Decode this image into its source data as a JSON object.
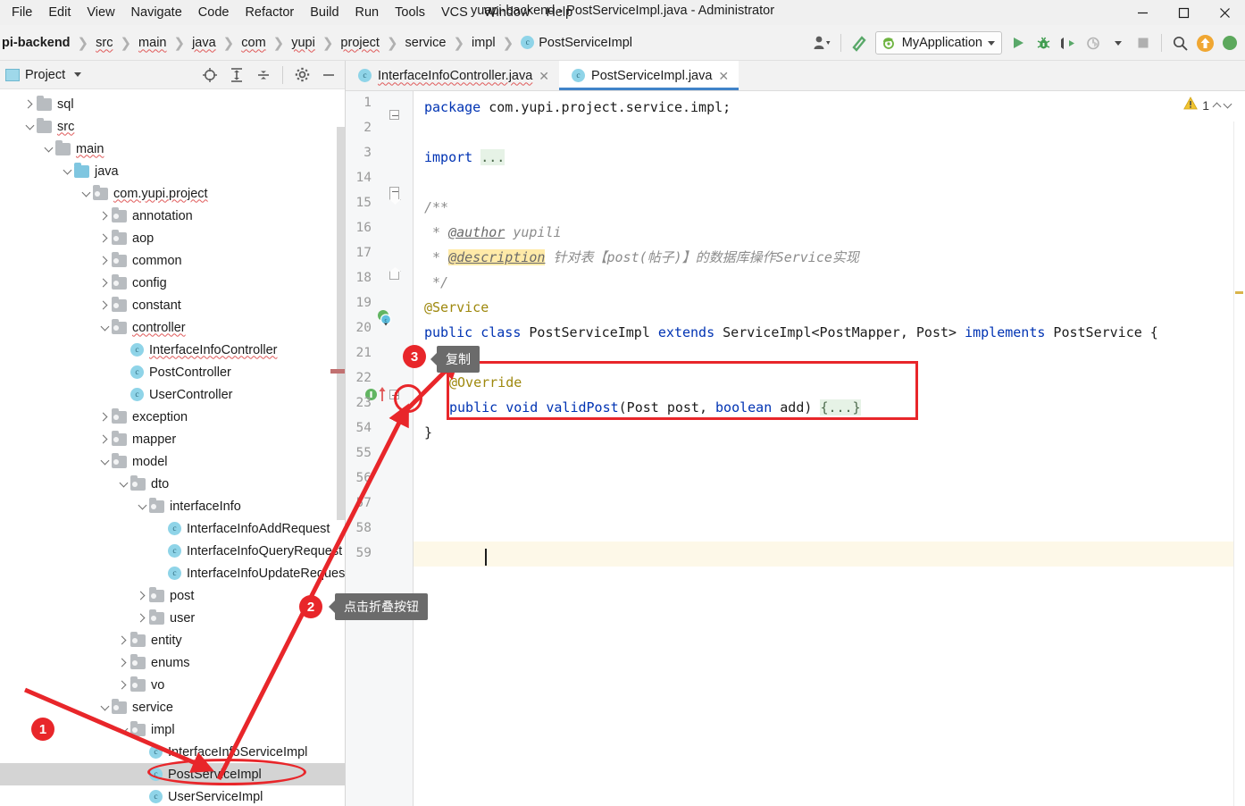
{
  "window": {
    "title": "yuapi-backend - PostServiceImpl.java - Administrator",
    "minimize": "–",
    "maximize": "□",
    "close": "✕"
  },
  "menubar": {
    "items": [
      {
        "label": "File"
      },
      {
        "label": "Edit"
      },
      {
        "label": "View"
      },
      {
        "label": "Navigate"
      },
      {
        "label": "Code"
      },
      {
        "label": "Refactor"
      },
      {
        "label": "Build"
      },
      {
        "label": "Run"
      },
      {
        "label": "Tools"
      },
      {
        "label": "VCS"
      },
      {
        "label": "Window"
      },
      {
        "label": "Help"
      }
    ]
  },
  "breadcrumb": {
    "separator": "❯",
    "items": [
      {
        "label": "pi-backend",
        "bold": true,
        "squiggle": false
      },
      {
        "label": "src",
        "bold": false,
        "squiggle": true
      },
      {
        "label": "main",
        "bold": false,
        "squiggle": true
      },
      {
        "label": "java",
        "bold": false,
        "squiggle": true
      },
      {
        "label": "com",
        "bold": false,
        "squiggle": true
      },
      {
        "label": "yupi",
        "bold": false,
        "squiggle": true
      },
      {
        "label": "project",
        "bold": false,
        "squiggle": true
      },
      {
        "label": "service",
        "bold": false,
        "squiggle": false
      },
      {
        "label": "impl",
        "bold": false,
        "squiggle": false
      }
    ],
    "current_class": "PostServiceImpl",
    "class_icon_letter": "c"
  },
  "toolbar": {
    "profile_icon": "user-profile-icon",
    "build_icon": "build-hammer-icon",
    "run_config": "MyApplication",
    "run_icon": "run-icon",
    "debug_icon": "debug-icon",
    "coverage_icon": "run-with-coverage-icon",
    "profiler_icon": "profiler-icon",
    "stop_icon": "stop-icon",
    "search_icon": "search-everywhere-icon",
    "update_icon": "update-project-icon"
  },
  "project_panel": {
    "title": "Project",
    "header_icons": [
      {
        "name": "locate-icon"
      },
      {
        "name": "expand-all-icon"
      },
      {
        "name": "collapse-all-icon"
      },
      {
        "name": "settings-gear-icon"
      },
      {
        "name": "hide-panel-icon"
      }
    ],
    "tree": [
      {
        "label": "sql",
        "indent": 1,
        "type": "folder",
        "state": "collapsed",
        "squiggle": false,
        "selected": false
      },
      {
        "label": "src",
        "indent": 1,
        "type": "folder",
        "state": "expanded",
        "squiggle": true,
        "selected": false
      },
      {
        "label": "main",
        "indent": 2,
        "type": "folder",
        "state": "expanded",
        "squiggle": true,
        "selected": false
      },
      {
        "label": "java",
        "indent": 3,
        "type": "source",
        "state": "expanded",
        "squiggle": false,
        "selected": false
      },
      {
        "label": "com.yupi.project",
        "indent": 4,
        "type": "package",
        "state": "expanded",
        "squiggle": true,
        "selected": false
      },
      {
        "label": "annotation",
        "indent": 5,
        "type": "package",
        "state": "collapsed",
        "squiggle": false,
        "selected": false
      },
      {
        "label": "aop",
        "indent": 5,
        "type": "package",
        "state": "collapsed",
        "squiggle": false,
        "selected": false
      },
      {
        "label": "common",
        "indent": 5,
        "type": "package",
        "state": "collapsed",
        "squiggle": false,
        "selected": false
      },
      {
        "label": "config",
        "indent": 5,
        "type": "package",
        "state": "collapsed",
        "squiggle": false,
        "selected": false
      },
      {
        "label": "constant",
        "indent": 5,
        "type": "package",
        "state": "collapsed",
        "squiggle": false,
        "selected": false
      },
      {
        "label": "controller",
        "indent": 5,
        "type": "package",
        "state": "expanded",
        "squiggle": true,
        "selected": false
      },
      {
        "label": "InterfaceInfoController",
        "indent": 6,
        "type": "class",
        "state": "leaf",
        "squiggle": true,
        "selected": false
      },
      {
        "label": "PostController",
        "indent": 6,
        "type": "class",
        "state": "leaf",
        "squiggle": false,
        "selected": false
      },
      {
        "label": "UserController",
        "indent": 6,
        "type": "class",
        "state": "leaf",
        "squiggle": false,
        "selected": false
      },
      {
        "label": "exception",
        "indent": 5,
        "type": "package",
        "state": "collapsed",
        "squiggle": false,
        "selected": false
      },
      {
        "label": "mapper",
        "indent": 5,
        "type": "package",
        "state": "collapsed",
        "squiggle": false,
        "selected": false
      },
      {
        "label": "model",
        "indent": 5,
        "type": "package",
        "state": "expanded",
        "squiggle": false,
        "selected": false
      },
      {
        "label": "dto",
        "indent": 6,
        "type": "package",
        "state": "expanded",
        "squiggle": false,
        "selected": false
      },
      {
        "label": "interfaceInfo",
        "indent": 7,
        "type": "package",
        "state": "expanded",
        "squiggle": false,
        "selected": false
      },
      {
        "label": "InterfaceInfoAddRequest",
        "indent": 8,
        "type": "class",
        "state": "leaf",
        "squiggle": false,
        "selected": false
      },
      {
        "label": "InterfaceInfoQueryRequest",
        "indent": 8,
        "type": "class",
        "state": "leaf",
        "squiggle": false,
        "selected": false
      },
      {
        "label": "InterfaceInfoUpdateRequest",
        "indent": 8,
        "type": "class",
        "state": "leaf",
        "squiggle": false,
        "selected": false
      },
      {
        "label": "post",
        "indent": 7,
        "type": "package",
        "state": "collapsed",
        "squiggle": false,
        "selected": false
      },
      {
        "label": "user",
        "indent": 7,
        "type": "package",
        "state": "collapsed",
        "squiggle": false,
        "selected": false
      },
      {
        "label": "entity",
        "indent": 6,
        "type": "package",
        "state": "collapsed",
        "squiggle": false,
        "selected": false
      },
      {
        "label": "enums",
        "indent": 6,
        "type": "package",
        "state": "collapsed",
        "squiggle": false,
        "selected": false
      },
      {
        "label": "vo",
        "indent": 6,
        "type": "package",
        "state": "collapsed",
        "squiggle": false,
        "selected": false
      },
      {
        "label": "service",
        "indent": 5,
        "type": "package",
        "state": "expanded",
        "squiggle": false,
        "selected": false
      },
      {
        "label": "impl",
        "indent": 6,
        "type": "package",
        "state": "expanded",
        "squiggle": false,
        "selected": false
      },
      {
        "label": "InterfaceInfoServiceImpl",
        "indent": 7,
        "type": "class",
        "state": "leaf",
        "squiggle": false,
        "selected": false
      },
      {
        "label": "PostServiceImpl",
        "indent": 7,
        "type": "class",
        "state": "leaf",
        "squiggle": false,
        "selected": true
      },
      {
        "label": "UserServiceImpl",
        "indent": 7,
        "type": "class",
        "state": "leaf",
        "squiggle": false,
        "selected": false
      }
    ]
  },
  "editor": {
    "tabs": [
      {
        "label": "InterfaceInfoController.java",
        "active": false,
        "squiggle": true,
        "close": "✕",
        "icon_letter": "c"
      },
      {
        "label": "PostServiceImpl.java",
        "active": true,
        "squiggle": false,
        "close": "✕",
        "icon_letter": "c"
      }
    ],
    "line_numbers": [
      "1",
      "2",
      "3",
      "14",
      "15",
      "16",
      "17",
      "18",
      "19",
      "20",
      "21",
      "22",
      "23",
      "54",
      "55",
      "56",
      "57",
      "58",
      "59"
    ],
    "inspection": {
      "warning_icon": "warning-triangle-icon",
      "warning_count": "1",
      "prev": "chevron-up-icon",
      "next": "chevron-down-icon"
    },
    "code_lines": [
      {
        "n": "1",
        "tokens": [
          {
            "t": "package",
            "c": "kw"
          },
          {
            "t": " com.yupi.project.service.impl;",
            "c": "txt"
          }
        ]
      },
      {
        "n": "2",
        "tokens": []
      },
      {
        "n": "3",
        "tokens": [
          {
            "t": "import",
            "c": "kw"
          },
          {
            "t": " ",
            "c": "txt"
          },
          {
            "t": "...",
            "c": "fold-ph"
          }
        ]
      },
      {
        "n": "14",
        "tokens": []
      },
      {
        "n": "15",
        "tokens": [
          {
            "t": "/**",
            "c": "cmt"
          }
        ]
      },
      {
        "n": "16",
        "tokens": [
          {
            "t": " * ",
            "c": "cmt"
          },
          {
            "t": "@author",
            "c": "cmt-tag"
          },
          {
            "t": " yupili",
            "c": "cmt"
          }
        ]
      },
      {
        "n": "17",
        "tokens": [
          {
            "t": " * ",
            "c": "cmt"
          },
          {
            "t": "@description",
            "c": "cmt-tag hl"
          },
          {
            "t": " 针对表【post(帖子)】的数据库操作Service实现",
            "c": "cmt"
          }
        ]
      },
      {
        "n": "18",
        "tokens": [
          {
            "t": " */",
            "c": "cmt"
          }
        ]
      },
      {
        "n": "19",
        "tokens": [
          {
            "t": "@Service",
            "c": "ann"
          }
        ]
      },
      {
        "n": "20",
        "tokens": [
          {
            "t": "public class",
            "c": "kw"
          },
          {
            "t": " PostServiceImpl ",
            "c": "txt"
          },
          {
            "t": "extends",
            "c": "kw"
          },
          {
            "t": " ServiceImpl<PostMapper, Post> ",
            "c": "txt"
          },
          {
            "t": "implements",
            "c": "kw"
          },
          {
            "t": " PostService {",
            "c": "txt"
          }
        ]
      },
      {
        "n": "21",
        "tokens": []
      },
      {
        "n": "22",
        "tokens": [
          {
            "t": "@Override",
            "c": "ann"
          }
        ]
      },
      {
        "n": "23",
        "tokens": [
          {
            "t": "public void",
            "c": "kw"
          },
          {
            "t": " ",
            "c": "txt"
          },
          {
            "t": "validPost",
            "c": "kw"
          },
          {
            "t": "(Post post, ",
            "c": "txt"
          },
          {
            "t": "boolean",
            "c": "kw"
          },
          {
            "t": " add) ",
            "c": "txt"
          },
          {
            "t": "{...}",
            "c": "fold-ph"
          }
        ]
      },
      {
        "n": "54",
        "tokens": [
          {
            "t": "}",
            "c": "txt"
          }
        ]
      },
      {
        "n": "55",
        "tokens": []
      },
      {
        "n": "56",
        "tokens": []
      },
      {
        "n": "57",
        "tokens": []
      },
      {
        "n": "58",
        "tokens": []
      },
      {
        "n": "59",
        "tokens": []
      }
    ],
    "gutter_markers": [
      {
        "name": "fold-plus-line-3",
        "line": "3"
      },
      {
        "name": "fold-collapse-line-15",
        "line": "15"
      },
      {
        "name": "fold-end-line-18",
        "line": "18"
      },
      {
        "name": "class-implemented-icon-line-20",
        "line": "20"
      },
      {
        "name": "method-overrides-icon-line-23",
        "line": "23"
      },
      {
        "name": "fold-plus-line-23",
        "line": "23"
      }
    ]
  },
  "annotations": {
    "badges": [
      {
        "label": "1",
        "name": "step-badge-1"
      },
      {
        "label": "2",
        "name": "step-badge-2"
      },
      {
        "label": "3",
        "name": "step-badge-3"
      }
    ],
    "tooltips": [
      {
        "text": "点击折叠按钮",
        "name": "tooltip-click-fold-button"
      },
      {
        "text": "复制",
        "name": "tooltip-copy"
      }
    ],
    "accent_color": "#e8262a"
  }
}
